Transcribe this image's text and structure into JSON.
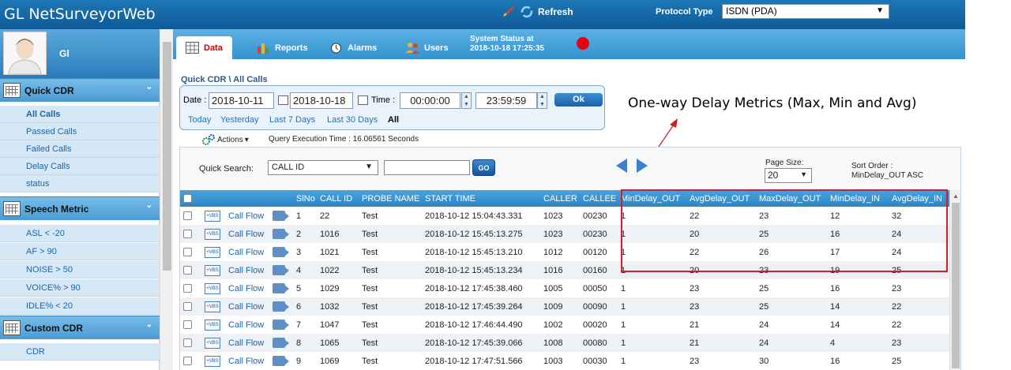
{
  "app": {
    "title": "GL NetSurveyorWeb",
    "refresh_label": "Refresh",
    "protocol_label": "Protocol Type",
    "protocol_value": "ISDN (PDA)"
  },
  "user": {
    "name": "Gl"
  },
  "sidebar": {
    "sections": [
      {
        "label": "Quick CDR",
        "items": [
          "All Calls",
          "Passed Calls",
          "Failed Calls",
          "Delay Calls",
          "status"
        ]
      },
      {
        "label": "Speech Metric",
        "items": [
          "ASL < -20",
          "AF > 90",
          "NOISE > 50",
          "VOICE% > 90",
          "IDLE% < 20"
        ]
      },
      {
        "label": "Custom CDR",
        "items": [
          "CDR"
        ]
      }
    ]
  },
  "tabs": [
    {
      "label": "Data",
      "active": true
    },
    {
      "label": "Reports"
    },
    {
      "label": "Alarms"
    },
    {
      "label": "Users"
    }
  ],
  "system_status": {
    "label": "System Status at",
    "time": "2018-10-18 17:25:35",
    "color": "#e8000f"
  },
  "breadcrumb": "Quick CDR \\ All Calls",
  "query": {
    "date_label": "Date :",
    "date_from": "2018-10-11",
    "date_to": "2018-10-18",
    "time_label": "Time :",
    "time_from": "00:00:00",
    "time_to": "23:59:59",
    "ok_label": "Ok",
    "quick_links": [
      "Today",
      "Yesterday",
      "Last 7 Days",
      "Last 30 Days",
      "All"
    ],
    "selected_link": "All"
  },
  "actions_label": "Actions",
  "exec_time": "Query Execution Time : 16.06561 Seconds",
  "annotation": "One-way Delay Metrics  (Max, Min and Avg)",
  "quick_search": {
    "label": "Quick Search:",
    "field": "CALL ID",
    "go_label": "GO"
  },
  "page_size": {
    "label": "Page Size:",
    "value": "20"
  },
  "sort_order": {
    "label": "Sort Order :",
    "value": "MinDelay_OUT ASC"
  },
  "table": {
    "columns": [
      "SlNo",
      "CALL ID",
      "PROBE NAME",
      "START TIME",
      "CALLER",
      "CALLEE",
      "MinDelay_OUT",
      "AvgDelay_OUT",
      "MaxDelay_OUT",
      "MinDelay_IN",
      "AvgDelay_IN"
    ],
    "vbs_label": "+VBS",
    "call_flow_label": "Call Flow",
    "rows": [
      [
        "1",
        "22",
        "Test",
        "2018-10-12 15:04:43.331",
        "1023",
        "00230",
        "1",
        "22",
        "23",
        "12",
        "32"
      ],
      [
        "2",
        "1016",
        "Test",
        "2018-10-12 15:45:13.275",
        "1023",
        "00230",
        "1",
        "20",
        "25",
        "16",
        "24"
      ],
      [
        "3",
        "1021",
        "Test",
        "2018-10-12 15:45:13.210",
        "1012",
        "00120",
        "1",
        "22",
        "26",
        "17",
        "24"
      ],
      [
        "4",
        "1022",
        "Test",
        "2018-10-12 15:45:13.234",
        "1016",
        "00160",
        "1",
        "20",
        "23",
        "19",
        "25"
      ],
      [
        "5",
        "1029",
        "Test",
        "2018-10-12 17:45:38.460",
        "1005",
        "00050",
        "1",
        "23",
        "25",
        "16",
        "23"
      ],
      [
        "6",
        "1032",
        "Test",
        "2018-10-12 17:45:39.264",
        "1009",
        "00090",
        "1",
        "23",
        "25",
        "14",
        "22"
      ],
      [
        "7",
        "1047",
        "Test",
        "2018-10-12 17:46:44.490",
        "1002",
        "00020",
        "1",
        "21",
        "24",
        "14",
        "22"
      ],
      [
        "8",
        "1065",
        "Test",
        "2018-10-12 17:45:39.066",
        "1008",
        "00080",
        "1",
        "21",
        "24",
        "4",
        "23"
      ],
      [
        "9",
        "1069",
        "Test",
        "2018-10-12 17:47:51.566",
        "1003",
        "00030",
        "1",
        "23",
        "30",
        "16",
        "25"
      ]
    ]
  },
  "colors": {
    "accent": "#2b86c7",
    "highlight": "#d41c2c"
  }
}
